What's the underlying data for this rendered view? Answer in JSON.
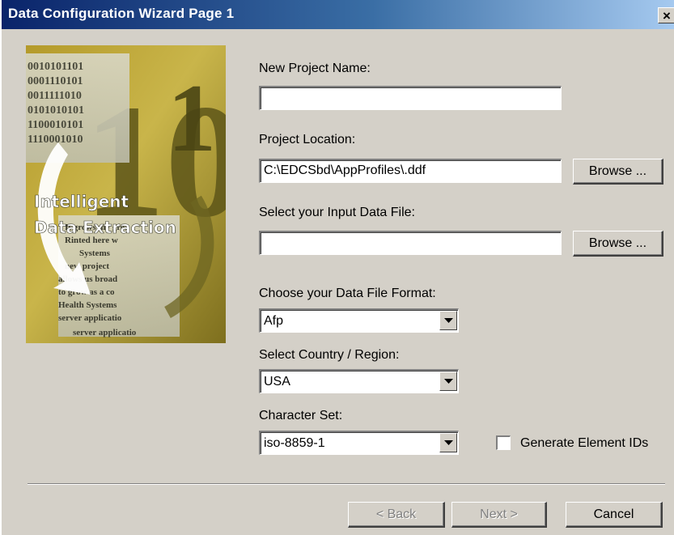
{
  "window": {
    "title": "Data Configuration Wizard Page 1",
    "close_glyph": "×"
  },
  "logo": {
    "line1": "Intelligent",
    "line2": "Data Extraction",
    "binary": [
      "0010101101",
      "0001110101",
      "0011111010",
      "0101010101",
      "1100010101",
      "1110001010"
    ],
    "big_digits": [
      "10",
      "1"
    ],
    "body_text": [
      "It grows my grea",
      "Rinted here w",
      "Systems",
      "new project",
      "allows us broad",
      "to grow as a co",
      "Health Systems",
      "server applicatio",
      "server applicatio"
    ]
  },
  "form": {
    "project_name_label": "New Project Name:",
    "project_name_value": "",
    "project_location_label": "Project Location:",
    "project_location_value": "C:\\EDCSbd\\AppProfiles\\.ddf",
    "input_file_label": "Select your Input Data File:",
    "input_file_value": "",
    "browse_label": "Browse ...",
    "format_label": "Choose your Data File Format:",
    "format_value": "Afp",
    "country_label": "Select Country / Region:",
    "country_value": "USA",
    "charset_label": "Character Set:",
    "charset_value": "iso-8859-1",
    "generate_ids_label": "Generate Element IDs",
    "generate_ids_checked": false
  },
  "footer": {
    "back_label": "< Back",
    "next_label": "Next >",
    "cancel_label": "Cancel"
  },
  "colors": {
    "titlebar_start": "#0a246a",
    "titlebar_end": "#a6caf0",
    "dialog_bg": "#d4d0c8"
  }
}
